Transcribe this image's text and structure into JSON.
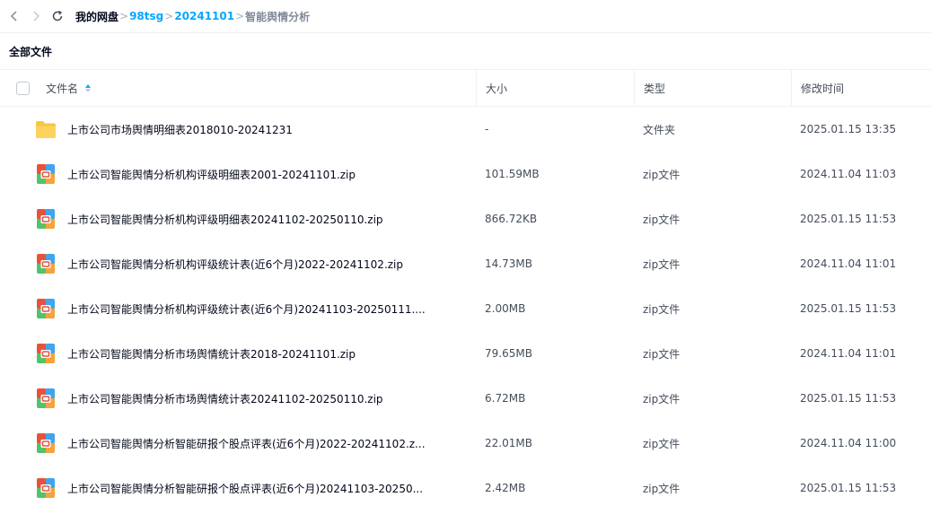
{
  "breadcrumb": {
    "items": [
      "我的网盘",
      "98tsg",
      "20241101",
      "智能舆情分析"
    ],
    "separator": ">"
  },
  "section_title": "全部文件",
  "columns": {
    "name": "文件名",
    "size": "大小",
    "type": "类型",
    "modified": "修改时间"
  },
  "files": [
    {
      "icon": "folder-icon",
      "name": "上市公司市场舆情明细表2018010-20241231",
      "size": "-",
      "type": "文件夹",
      "modified": "2025.01.15 13:35"
    },
    {
      "icon": "zip-icon",
      "name": "上市公司智能舆情分析机构评级明细表2001-20241101.zip",
      "size": "101.59MB",
      "type": "zip文件",
      "modified": "2024.11.04 11:03"
    },
    {
      "icon": "zip-icon",
      "name": "上市公司智能舆情分析机构评级明细表20241102-20250110.zip",
      "size": "866.72KB",
      "type": "zip文件",
      "modified": "2025.01.15 11:53"
    },
    {
      "icon": "zip-icon",
      "name": "上市公司智能舆情分析机构评级统计表(近6个月)2022-20241102.zip",
      "size": "14.73MB",
      "type": "zip文件",
      "modified": "2024.11.04 11:01"
    },
    {
      "icon": "zip-icon",
      "name": "上市公司智能舆情分析机构评级统计表(近6个月)20241103-20250111....",
      "size": "2.00MB",
      "type": "zip文件",
      "modified": "2025.01.15 11:53"
    },
    {
      "icon": "zip-icon",
      "name": "上市公司智能舆情分析市场舆情统计表2018-20241101.zip",
      "size": "79.65MB",
      "type": "zip文件",
      "modified": "2024.11.04 11:01"
    },
    {
      "icon": "zip-icon",
      "name": "上市公司智能舆情分析市场舆情统计表20241102-20250110.zip",
      "size": "6.72MB",
      "type": "zip文件",
      "modified": "2025.01.15 11:53"
    },
    {
      "icon": "zip-icon",
      "name": "上市公司智能舆情分析智能研报个股点评表(近6个月)2022-20241102.z...",
      "size": "22.01MB",
      "type": "zip文件",
      "modified": "2024.11.04 11:00"
    },
    {
      "icon": "zip-icon",
      "name": "上市公司智能舆情分析智能研报个股点评表(近6个月)20241103-20250...",
      "size": "2.42MB",
      "type": "zip文件",
      "modified": "2025.01.15 11:53"
    }
  ],
  "colors": {
    "accent": "#06a7ff",
    "folder": "#f9c543"
  }
}
